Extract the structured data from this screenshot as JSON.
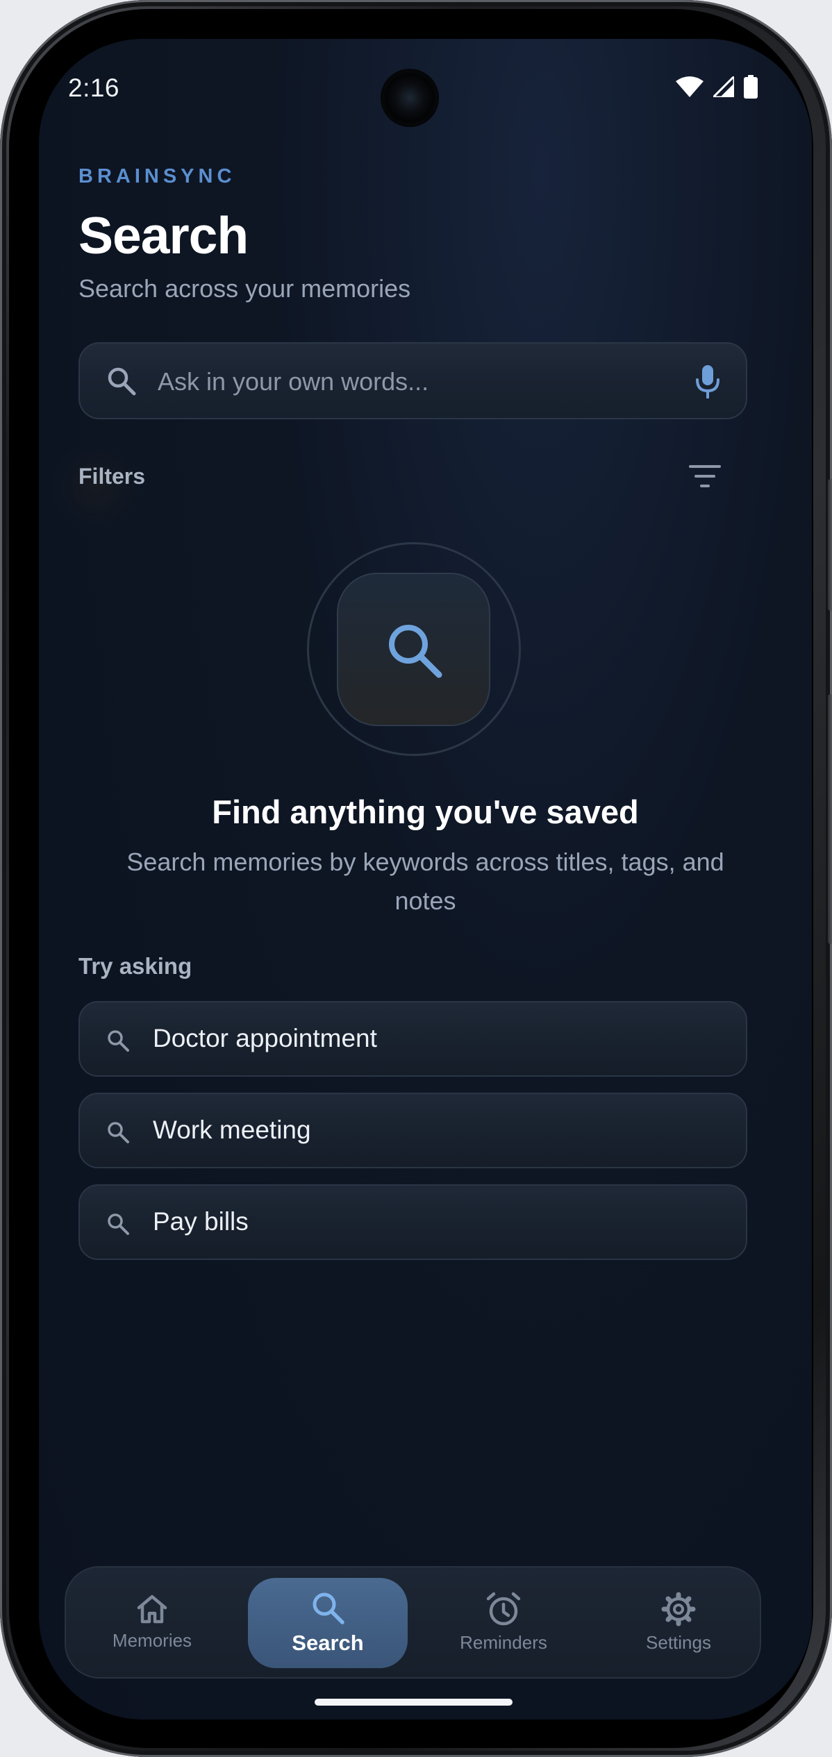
{
  "status_bar": {
    "time": "2:16",
    "icons": [
      "wifi-icon",
      "cellular-signal-icon",
      "battery-icon"
    ]
  },
  "header": {
    "brand": "BRAINSYNC",
    "title": "Search",
    "subtitle": "Search across your memories"
  },
  "search": {
    "placeholder": "Ask in your own words...",
    "value": "",
    "leading_icon": "search-icon",
    "trailing_icon": "microphone-icon"
  },
  "filters": {
    "label": "Filters",
    "icon": "filter-icon"
  },
  "empty_state": {
    "icon": "search-icon",
    "title": "Find anything you've saved",
    "description": "Search memories by keywords across titles, tags, and notes"
  },
  "suggestions": {
    "label": "Try asking",
    "items": [
      {
        "text": "Doctor appointment",
        "icon": "search-icon"
      },
      {
        "text": "Work meeting",
        "icon": "search-icon"
      },
      {
        "text": "Pay bills",
        "icon": "search-icon"
      }
    ]
  },
  "bottom_nav": {
    "active": "Search",
    "items": [
      {
        "label": "Memories",
        "icon": "home-icon"
      },
      {
        "label": "Search",
        "icon": "search-icon"
      },
      {
        "label": "Reminders",
        "icon": "alarm-clock-icon"
      },
      {
        "label": "Settings",
        "icon": "gear-icon"
      }
    ]
  },
  "colors": {
    "background": "#0b1220",
    "accent": "#5b8fd0",
    "active_nav": "#42618a",
    "text_primary": "#ffffff",
    "text_secondary": "#9aa6b8"
  }
}
